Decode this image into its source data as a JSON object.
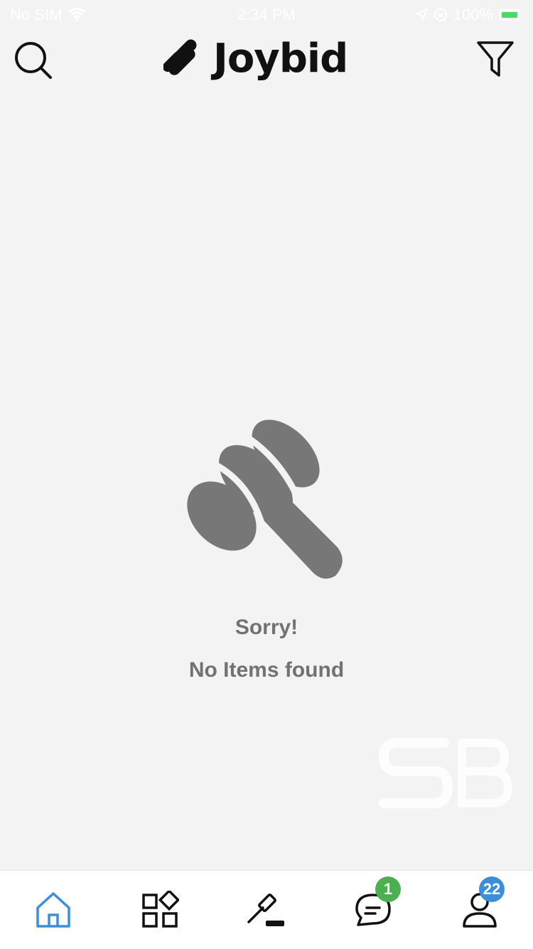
{
  "status_bar": {
    "carrier": "No SIM",
    "time": "2:34 PM",
    "battery": "100%"
  },
  "header": {
    "app_name": "Joybid",
    "search_icon": "search-icon",
    "filter_icon": "filter-icon"
  },
  "empty_state": {
    "icon": "gavel-icon",
    "title": "Sorry!",
    "message": "No Items found"
  },
  "tab_bar": {
    "tabs": [
      {
        "name": "home",
        "icon": "home-icon",
        "active": true
      },
      {
        "name": "categories",
        "icon": "categories-icon",
        "active": false
      },
      {
        "name": "auctions",
        "icon": "gavel-icon",
        "active": false
      },
      {
        "name": "messages",
        "icon": "chat-icon",
        "active": false,
        "badge": "1"
      },
      {
        "name": "profile",
        "icon": "user-icon",
        "active": false,
        "badge": "22"
      }
    ]
  },
  "colors": {
    "background": "#f3f3f3",
    "active_tab": "#3b8fd9",
    "message_badge": "#4caf50",
    "profile_badge": "#3b8fd9",
    "empty_text": "#727272",
    "gavel": "#777777"
  }
}
